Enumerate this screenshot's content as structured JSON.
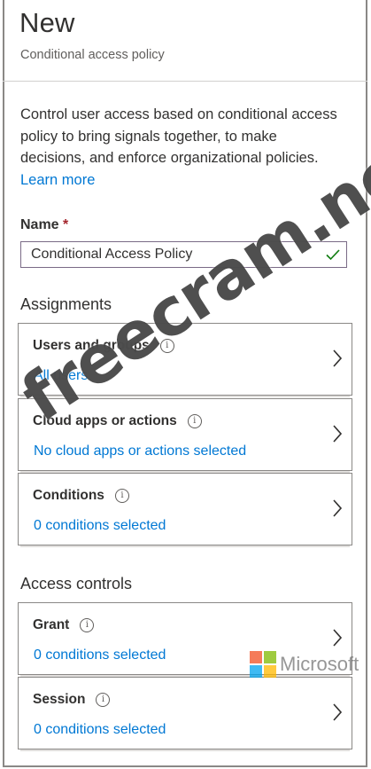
{
  "header": {
    "title": "New",
    "subtitle": "Conditional access policy"
  },
  "description": {
    "text": "Control user access based on conditional access policy to bring signals together, to make decisions, and enforce organizational policies.",
    "learn_more": "Learn more"
  },
  "name_field": {
    "label": "Name",
    "required_marker": "*",
    "value": "Conditional Access Policy",
    "valid_icon": "checkmark-icon"
  },
  "assignments": {
    "heading": "Assignments",
    "items": [
      {
        "title": "Users and groups",
        "value": "All users"
      },
      {
        "title": "Cloud apps or actions",
        "value": "No cloud apps or actions selected"
      },
      {
        "title": "Conditions",
        "value": "0 conditions selected"
      }
    ]
  },
  "access_controls": {
    "heading": "Access controls",
    "items": [
      {
        "title": "Grant",
        "value": "0 conditions selected"
      },
      {
        "title": "Session",
        "value": "0 conditions selected"
      }
    ]
  },
  "icons": {
    "info": "info-icon",
    "chevron": "chevron-right-icon"
  },
  "colors": {
    "link": "#0078d4",
    "required": "#a4262c",
    "valid": "#107c10"
  },
  "watermark": {
    "text": "freecram.net"
  },
  "logo": {
    "text": "Microsoft"
  }
}
